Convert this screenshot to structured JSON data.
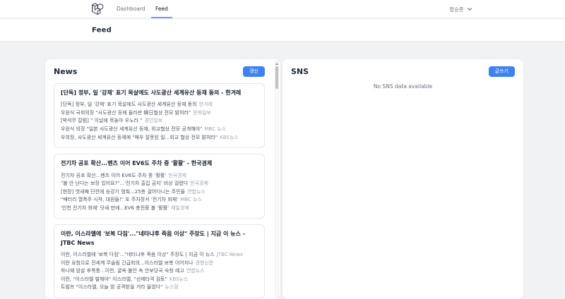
{
  "navbar": {
    "links": [
      {
        "label": "Dashboard",
        "active": false
      },
      {
        "label": "Feed",
        "active": true
      }
    ],
    "user": {
      "name": "정승준"
    }
  },
  "header": {
    "title": "Feed"
  },
  "colors": {
    "accent_blue": "#3b82f6",
    "active_tab_underline": "#818cf8",
    "page_background": "#f1f2f4"
  },
  "icons": {
    "brand": "laravel-logo",
    "user_menu": "chevron-down-icon",
    "news_scrollbar": "scroll-up-arrow"
  },
  "news": {
    "title": "News",
    "refresh_button": "갱신",
    "cards": [
      {
        "title": "[단독] 정부, 일 '강제' 표기 묵살에도 사도광산 세계유산 등재 동의 - 한겨레",
        "items": [
          {
            "text": "[단독] 정부, 일 '강제' 표기 묵살에도 사도광산 세계유산 등재 동의",
            "source": "한겨레"
          },
          {
            "text": "우원식 국회의장 \"사도광산 등재 둘러싼 韓日협상 전모 밝혀라\"",
            "source": "문화일보"
          },
          {
            "text": "[박석무 칼럼] \" 이날에 목놓아 우노라 \"",
            "source": "경인일보"
          },
          {
            "text": "우원식 의장 \"일본 사도광산 세계유산 등재, 외교협상 전모 공개해야\"",
            "source": "MBC 뉴스"
          },
          {
            "text": "우의장, 사도광산 세계유산 등재에 \"매우 잘못된 일...외교 협상 전모 밝혀라\"",
            "source": "KBS뉴스"
          }
        ]
      },
      {
        "title": "전기차 공포 확산...벤츠 이어 EV6도 주차 중 '활활' - 한국경제",
        "items": [
          {
            "text": "전기차 공포 확산...벤츠 이어 EV6도 주차 중 '활활'",
            "source": "한국경제"
          },
          {
            "text": "\"불 안 난다는 보장 있어요?\"...'전기차 출입 금지' 비상 걸렸다",
            "source": "한국경제"
          },
          {
            "text": "[현장] 엿새째 단전에 승강기 멈춰...25층 걸어다니는 주민들",
            "source": "연합뉴스"
          },
          {
            "text": "\"배터리 열폭주 시작, 대원들!\" 또 주차장서 '전기차 화재'",
            "source": "MBC 뉴스"
          },
          {
            "text": "'인천 전기차 화재' 닷새 만에...EV6 충전중 불 '활활'",
            "source": "매일경제"
          }
        ]
      },
      {
        "title": "이란, 이스라엘에 '보복 다짐'...\"네타냐후 죽음 이상\" 주장도 | 지금 이 뉴스 - JTBC News",
        "items": [
          {
            "text": "이란, 이스라엘에 '보복 다짐'...\"네타냐후 죽음 이상\" 주장도 | 지금 이 뉴스",
            "source": "JTBC News"
          },
          {
            "text": "이란 요청으로 전세계 무슬림 긴급회의...이스라엘 보복 이어지나",
            "source": "경향신문"
          },
          {
            "text": "하니예 암살 후폭풍...이란, 굴욕·불안 속 안보당국 숙청 예고",
            "source": "연합뉴스"
          },
          {
            "text": "이란, \"이스라엘 벌해야\" 이스라엘, \"선제타격 검토\"",
            "source": "KBS뉴스"
          },
          {
            "text": "트럼프 \"이스라엘, 오늘 밤 공격받을 거라 들었다\"",
            "source": "뉴스핌"
          }
        ]
      }
    ]
  },
  "sns": {
    "title": "SNS",
    "write_button": "글쓰기",
    "empty_message": "No SNS data available"
  }
}
